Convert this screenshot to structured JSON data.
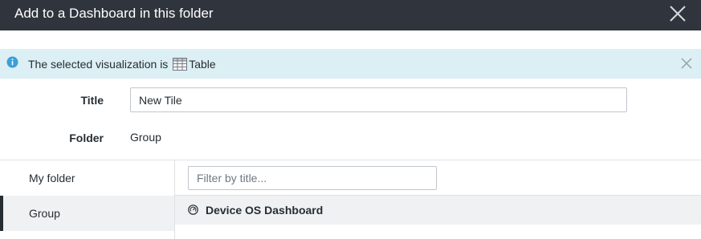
{
  "dialog": {
    "title": "Add to a Dashboard in this folder",
    "close_icon": "close-icon"
  },
  "banner": {
    "text_before": "The selected visualization is ",
    "visualization_name": "Table",
    "info_icon": "info-icon",
    "table_icon": "table-icon",
    "dismiss_icon": "close-icon",
    "background_color": "#dbeff4",
    "info_color": "#3b9fd8"
  },
  "form": {
    "title_label": "Title",
    "title_value": "New Tile",
    "folder_label": "Folder",
    "folder_value": "Group"
  },
  "sidebar": {
    "items": [
      {
        "label": "My folder",
        "selected": false
      },
      {
        "label": "Group",
        "selected": true
      }
    ]
  },
  "dashboards": {
    "filter_placeholder": "Filter by title...",
    "filter_value": "",
    "items": [
      {
        "label": "Device OS Dashboard",
        "icon": "dashboard-icon"
      }
    ]
  },
  "colors": {
    "header_background": "#2f343d",
    "selected_background": "#f0f1f2",
    "selected_bar": "#262d33"
  }
}
